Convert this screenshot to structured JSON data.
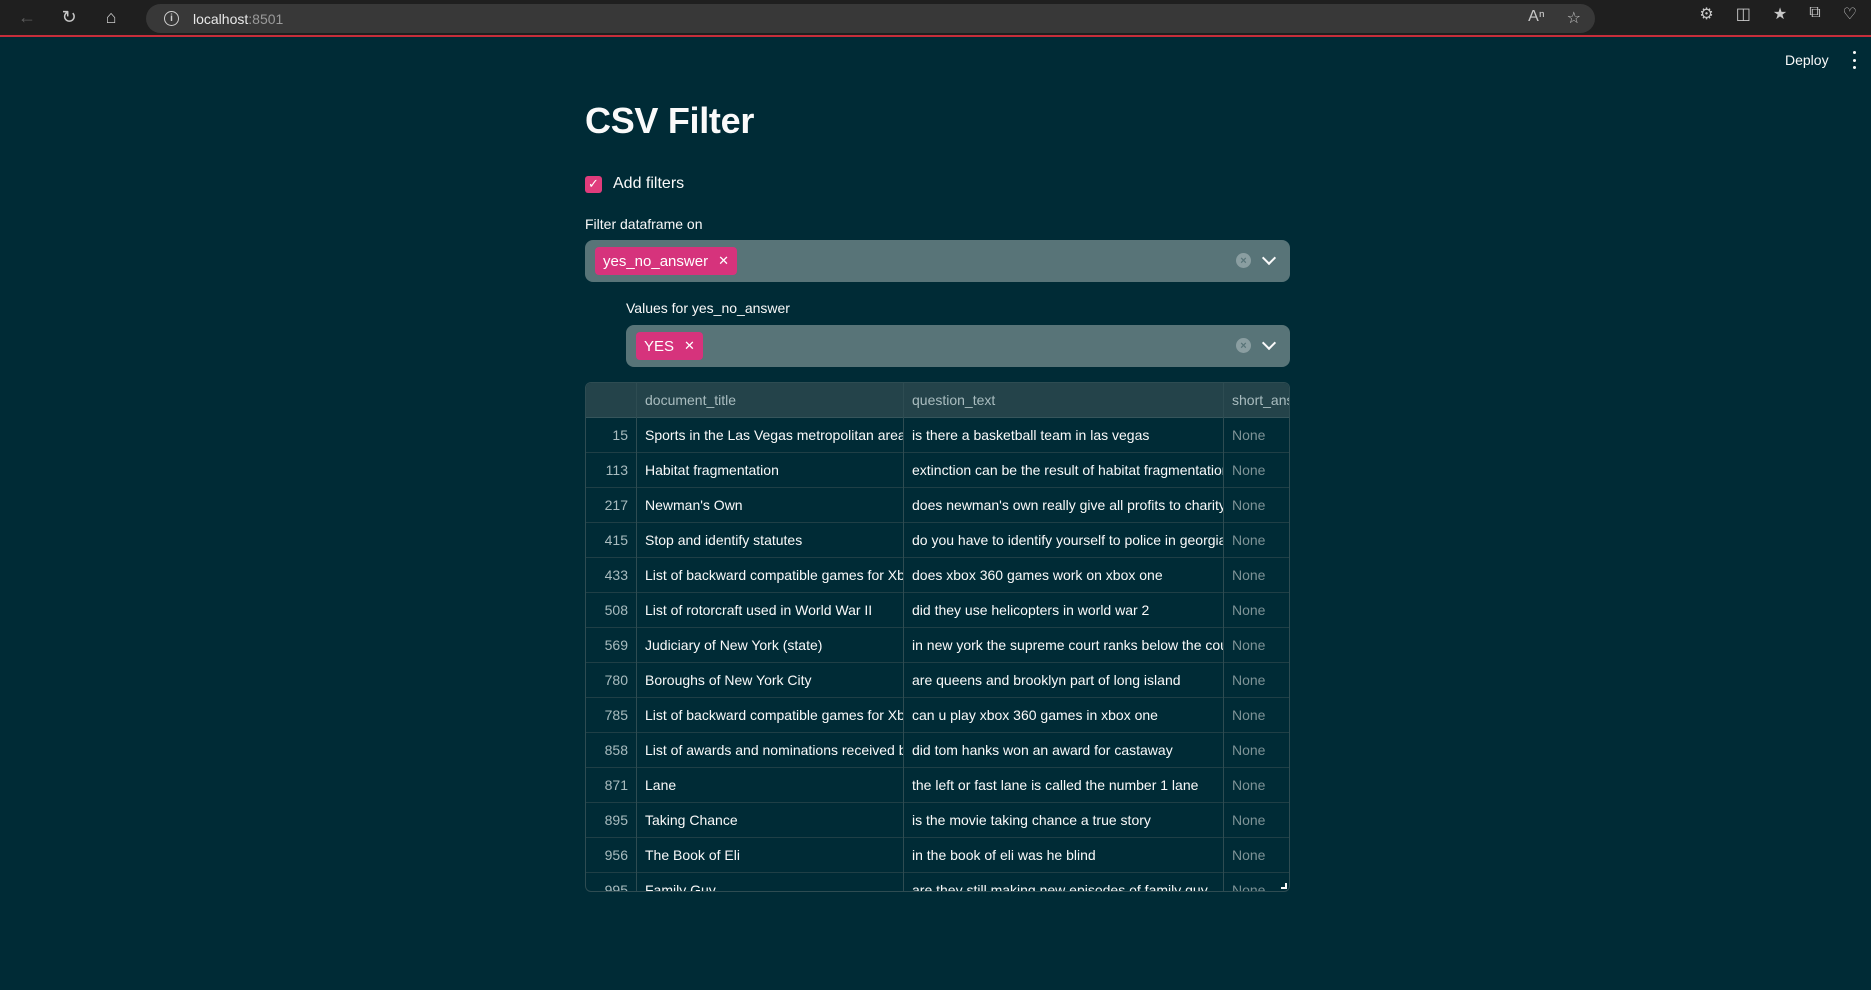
{
  "browser": {
    "url_host": "localhost",
    "url_port": ":8501"
  },
  "header": {
    "deploy_label": "Deploy"
  },
  "main": {
    "title": "CSV Filter",
    "add_filters_label": "Add filters",
    "add_filters_checked": true,
    "filter_label": "Filter dataframe on",
    "filter_tags": [
      "yes_no_answer"
    ],
    "values_label": "Values for yes_no_answer",
    "values_tags": [
      "YES"
    ]
  },
  "table": {
    "columns": [
      "",
      "document_title",
      "question_text",
      "short_ans"
    ],
    "rows": [
      {
        "idx": "15",
        "title": "Sports in the Las Vegas metropolitan area",
        "question": "is there a basketball team in las vegas",
        "short": "None"
      },
      {
        "idx": "113",
        "title": "Habitat fragmentation",
        "question": "extinction can be the result of habitat fragmentation",
        "short": "None"
      },
      {
        "idx": "217",
        "title": "Newman's Own",
        "question": "does newman's own really give all profits to charity",
        "short": "None"
      },
      {
        "idx": "415",
        "title": "Stop and identify statutes",
        "question": "do you have to identify yourself to police in georgia",
        "short": "None"
      },
      {
        "idx": "433",
        "title": "List of backward compatible games for Xbox",
        "question": "does xbox 360 games work on xbox one",
        "short": "None"
      },
      {
        "idx": "508",
        "title": "List of rotorcraft used in World War II",
        "question": "did they use helicopters in world war 2",
        "short": "None"
      },
      {
        "idx": "569",
        "title": "Judiciary of New York (state)",
        "question": "in new york the supreme court ranks below the court of",
        "short": "None"
      },
      {
        "idx": "780",
        "title": "Boroughs of New York City",
        "question": "are queens and brooklyn part of long island",
        "short": "None"
      },
      {
        "idx": "785",
        "title": "List of backward compatible games for Xbox",
        "question": "can u play xbox 360 games in xbox one",
        "short": "None"
      },
      {
        "idx": "858",
        "title": "List of awards and nominations received by Tom",
        "question": "did tom hanks won an award for castaway",
        "short": "None"
      },
      {
        "idx": "871",
        "title": "Lane",
        "question": "the left or fast lane is called the number 1 lane",
        "short": "None"
      },
      {
        "idx": "895",
        "title": "Taking Chance",
        "question": "is the movie taking chance a true story",
        "short": "None"
      },
      {
        "idx": "956",
        "title": "The Book of Eli",
        "question": "in the book of eli was he blind",
        "short": "None"
      },
      {
        "idx": "995",
        "title": "Family Guy",
        "question": "are they still making new episodes of family guy",
        "short": "None"
      }
    ]
  },
  "colors": {
    "background": "#002b36",
    "accent": "#d6337c",
    "input_bg": "#587478"
  }
}
